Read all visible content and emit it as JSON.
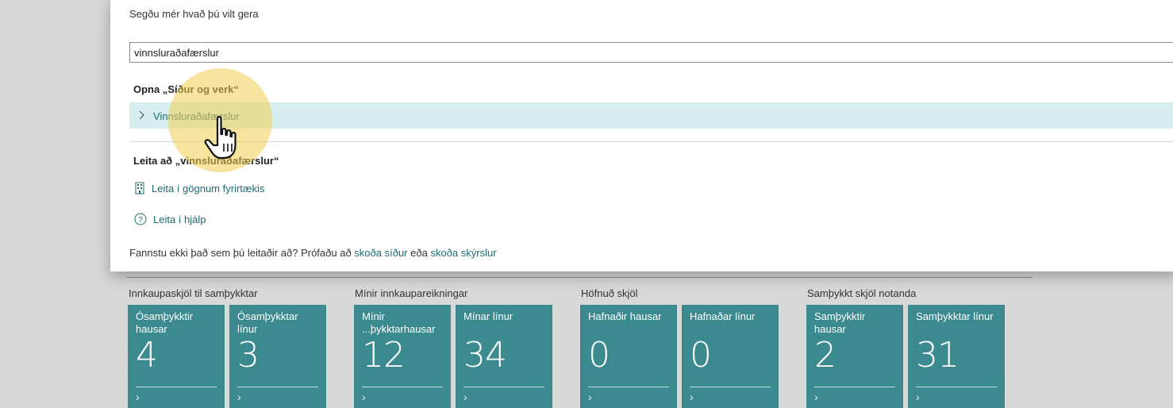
{
  "dialog": {
    "prompt": "Segðu mér hvað þú vilt gera",
    "search_value": "vinnsluraðafærslur",
    "section_pages": "Opna „Síður og verk“",
    "result_label": "Vinnsluraðafærslur",
    "section_search": "Leita að „vinnsluraðafærslur“",
    "action_company_data": "Leita í gögnum fyrirtækis",
    "action_help": "Leita í hjálp",
    "footer_text": "Fannstu ekki það sem þú leitaðir að? Prófaðu að",
    "footer_link_pages": "skoða síður",
    "footer_or": "eða",
    "footer_link_reports": "skoða skýrslur"
  },
  "dashboard": {
    "groups": [
      {
        "title": "Innkaupaskjöl til samþykktar",
        "tiles": [
          {
            "label": "Ósamþykktir hausar",
            "value": "4"
          },
          {
            "label": "Ósamþykktar línur",
            "value": "3"
          }
        ]
      },
      {
        "title": "Mínir innkaupareikningar",
        "tiles": [
          {
            "label": "Mínir ...þykktarhausar",
            "value": "12"
          },
          {
            "label": "Mínar línur",
            "value": "34"
          }
        ]
      },
      {
        "title": "Höfnuð skjöl",
        "tiles": [
          {
            "label": "Hafnaðir hausar",
            "value": "0"
          },
          {
            "label": "Hafnaðar línur",
            "value": "0"
          }
        ]
      },
      {
        "title": "Samþykkt skjöl notanda",
        "tiles": [
          {
            "label": "Samþykktir hausar",
            "value": "2"
          },
          {
            "label": "Samþykktar línur",
            "value": "31"
          }
        ]
      }
    ]
  },
  "colors": {
    "tile_bg": "#3b8a8f",
    "accent_text": "#1f6b70",
    "selected_row": "#d7eef0",
    "click_highlight": "#f0d050"
  }
}
